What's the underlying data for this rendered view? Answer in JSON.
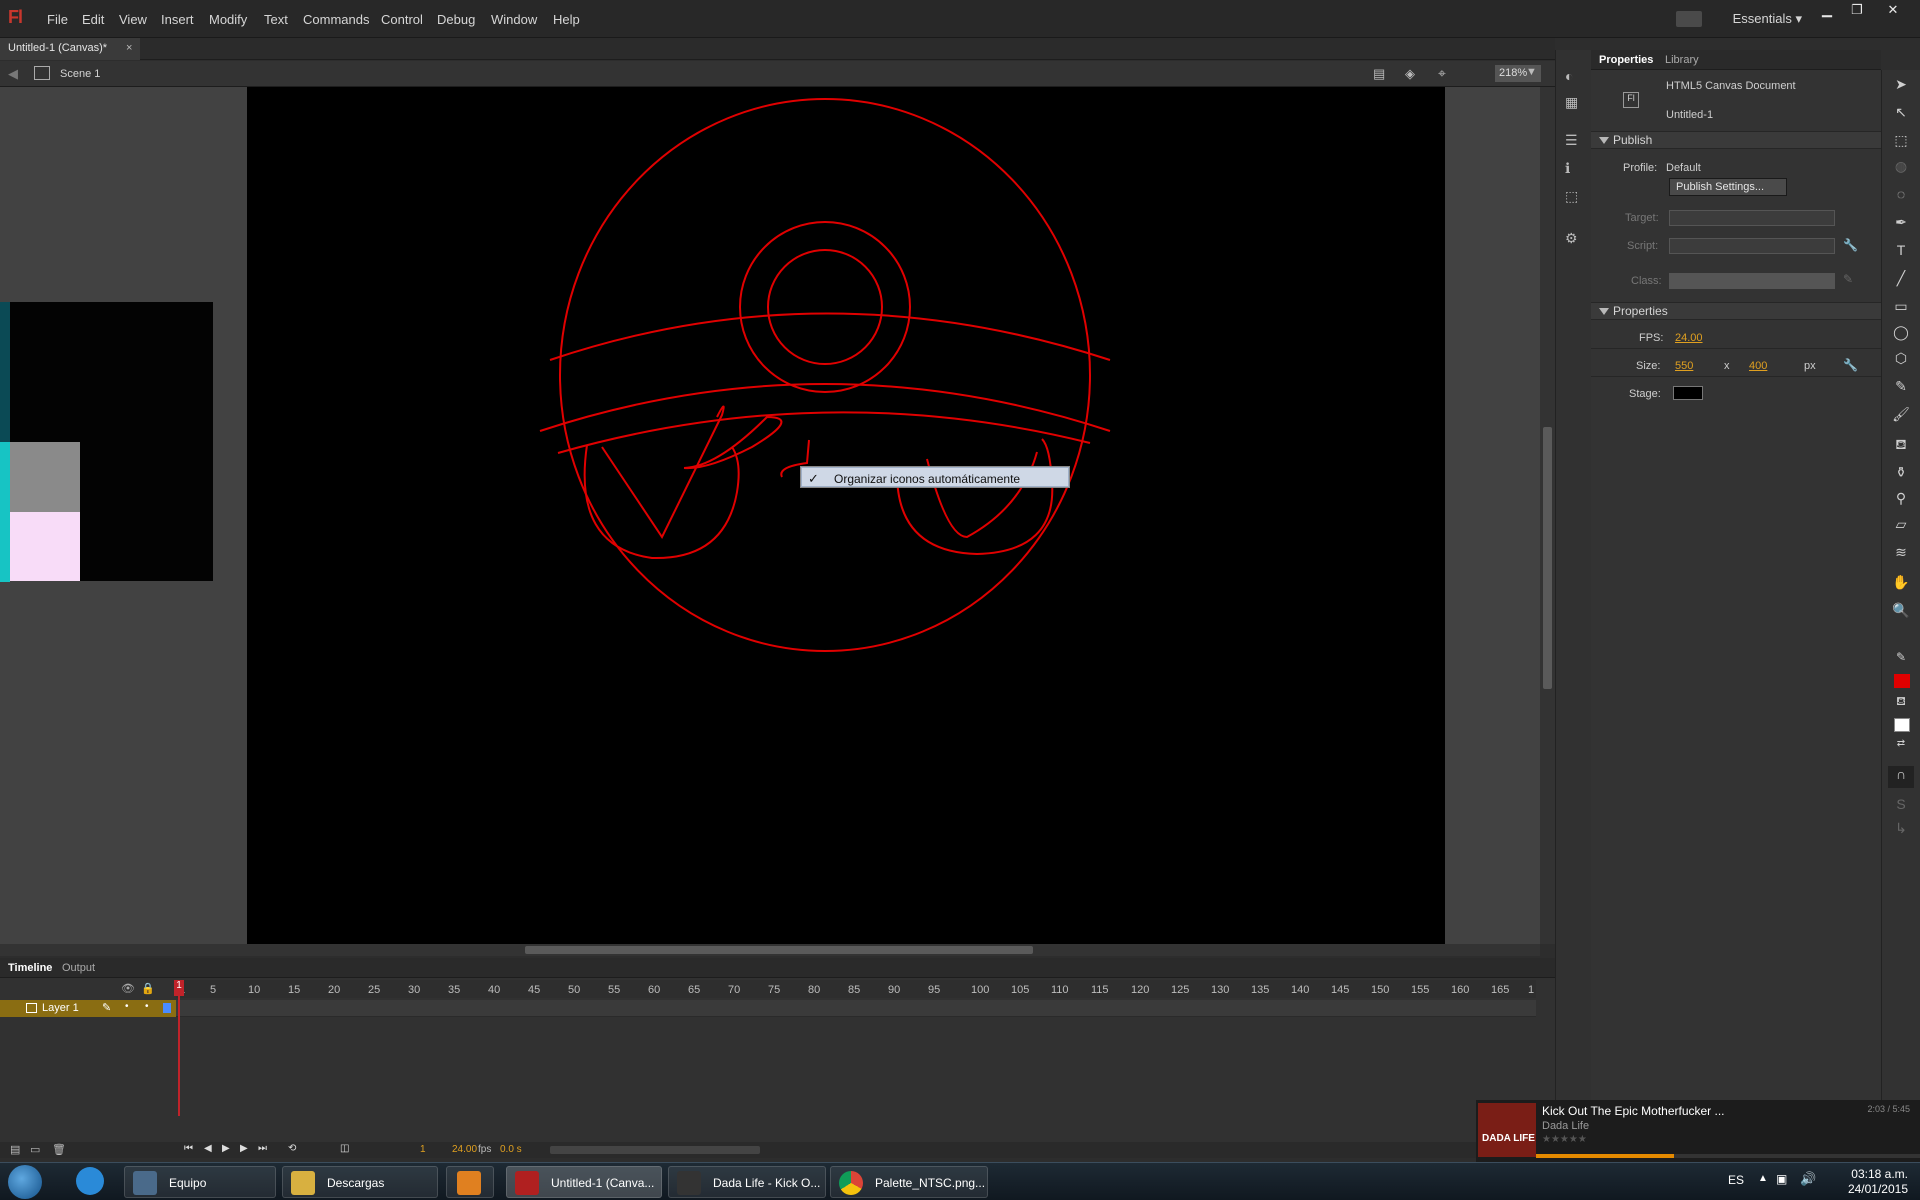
{
  "app": {
    "logo": "Fl",
    "workspace": "Essentials"
  },
  "menu": [
    "File",
    "Edit",
    "View",
    "Insert",
    "Modify",
    "Text",
    "Commands",
    "Control",
    "Debug",
    "Window",
    "Help"
  ],
  "document": {
    "tab_title": "Untitled-1 (Canvas)*",
    "tab_close": "×",
    "scene": "Scene 1",
    "zoom": "218%"
  },
  "context_menu": {
    "check": "✓",
    "label": "Organizar iconos automáticamente"
  },
  "timeline": {
    "tabs": [
      "Timeline",
      "Output"
    ],
    "layer_name": "Layer 1",
    "ruler": [
      "1",
      "5",
      "10",
      "15",
      "20",
      "25",
      "30",
      "35",
      "40",
      "45",
      "50",
      "55",
      "60",
      "65",
      "70",
      "75",
      "80",
      "85",
      "90",
      "95",
      "100",
      "105",
      "110",
      "115",
      "120",
      "125",
      "130",
      "135",
      "140",
      "145",
      "150",
      "155",
      "160",
      "165",
      "1"
    ],
    "current_frame": "1",
    "fps": "24.00",
    "fps_unit": "fps",
    "elapsed": "0.0 s"
  },
  "properties": {
    "tabs": [
      "Properties",
      "Library"
    ],
    "doc_type": "HTML5 Canvas Document",
    "doc_name": "Untitled-1",
    "doc_icon_text": "Fl",
    "publish_section": "Publish",
    "profile_label": "Profile:",
    "profile_value": "Default",
    "publish_button": "Publish Settings...",
    "target_label": "Target:",
    "script_label": "Script:",
    "class_label": "Class:",
    "properties_section": "Properties",
    "fps_label": "FPS:",
    "fps_value": "24.00",
    "size_label": "Size:",
    "width": "550",
    "x_sep": "x",
    "height": "400",
    "unit": "px",
    "stage_label": "Stage:",
    "stage_color": "#000000"
  },
  "taskbar": {
    "items": [
      {
        "label": "Equipo"
      },
      {
        "label": "Descargas"
      },
      {
        "label": ""
      },
      {
        "label": "Untitled-1 (Canva..."
      },
      {
        "label": "Dada Life - Kick O..."
      },
      {
        "label": "Palette_NTSC.png..."
      }
    ],
    "lang": "ES",
    "time": "03:18 a.m.",
    "date": "24/01/2015"
  },
  "media": {
    "title": "Kick Out The Epic Motherfucker ...",
    "artist": "Dada Life",
    "time": "2:03 / 5:45",
    "album_text": "DADA LIFE",
    "progress": 0.36
  },
  "colors": {
    "drawing_stroke": "#e00000",
    "stage_bg": "#000000",
    "layer_highlight": "#8a6d12"
  }
}
